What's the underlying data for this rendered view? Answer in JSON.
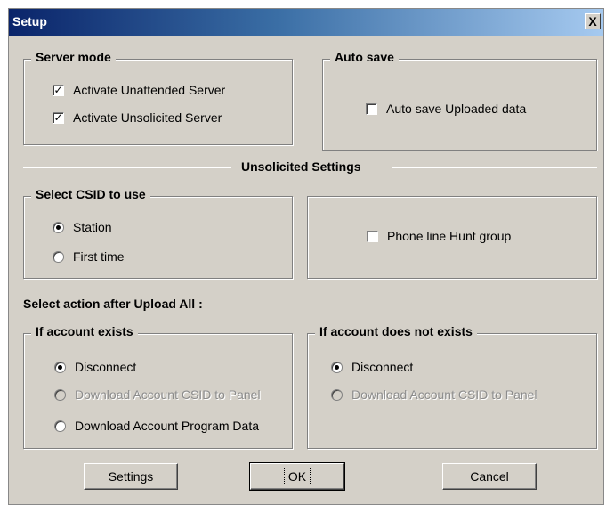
{
  "window": {
    "title": "Setup",
    "close_label": "X"
  },
  "server_mode": {
    "legend": "Server mode",
    "unattended": {
      "label": "Activate Unattended Server",
      "checked": true
    },
    "unsolicited": {
      "label": "Activate  Unsolicited Server",
      "checked": true
    }
  },
  "auto_save": {
    "legend": "Auto save",
    "uploaded": {
      "label": "Auto save Uploaded data",
      "checked": false
    }
  },
  "unsolicited_settings": {
    "title": "Unsolicited Settings"
  },
  "csid": {
    "legend": "Select CSID to use",
    "station": {
      "label": "Station",
      "selected": true
    },
    "first_time": {
      "label": "First time",
      "selected": false
    }
  },
  "hunt_group": {
    "label": "Phone line Hunt group",
    "checked": false
  },
  "upload_action": {
    "title": "Select action after Upload All :"
  },
  "account_exists": {
    "legend": "If account exists",
    "disconnect": {
      "label": "Disconnect",
      "selected": true
    },
    "download_csid": {
      "label": "Download Account CSID to Panel",
      "selected": false,
      "disabled": true
    },
    "download_program": {
      "label": "Download Account Program Data",
      "selected": false
    }
  },
  "account_not_exists": {
    "legend": "If account does not exists",
    "disconnect": {
      "label": "Disconnect",
      "selected": true
    },
    "download_csid": {
      "label": "Download Account CSID to Panel",
      "selected": false,
      "disabled": true
    }
  },
  "buttons": {
    "settings": "Settings",
    "ok": "OK",
    "cancel": "Cancel"
  }
}
